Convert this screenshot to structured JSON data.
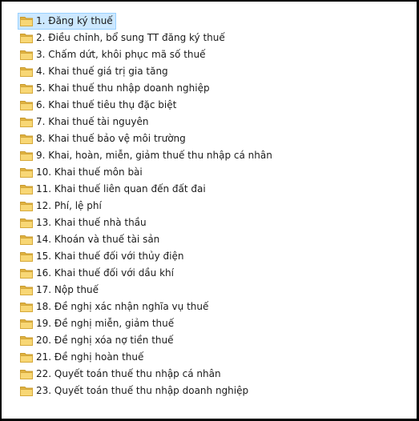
{
  "folders": {
    "selected_index": 0,
    "icon": "folder-icon",
    "colors": {
      "selection_fill": "#cce8ff",
      "selection_border": "#99d1ff",
      "folder_back": "#e0b240",
      "folder_front": "#f8d775"
    },
    "items": [
      {
        "label": "1. Đăng ký thuế"
      },
      {
        "label": "2. Điều chỉnh, bổ sung TT đăng ký thuế"
      },
      {
        "label": "3. Chấm dứt, khôi phục mã số thuế"
      },
      {
        "label": "4. Khai thuế giá trị gia tăng"
      },
      {
        "label": "5. Khai thuế thu nhập doanh nghiệp"
      },
      {
        "label": "6. Khai thuế tiêu thụ đặc biệt"
      },
      {
        "label": "7. Khai thuế tài nguyên"
      },
      {
        "label": "8. Khai thuế bảo vệ môi trường"
      },
      {
        "label": "9. Khai, hoàn, miễn, giảm thuế thu nhập cá nhân"
      },
      {
        "label": "10. Khai thuế môn bài"
      },
      {
        "label": "11. Khai thuế liên quan đến đất đai"
      },
      {
        "label": "12. Phí, lệ phí"
      },
      {
        "label": "13. Khai thuế nhà thầu"
      },
      {
        "label": "14. Khoán và thuế tài sản"
      },
      {
        "label": "15. Khai thuế đối với thủy điện"
      },
      {
        "label": "16. Khai thuế đối với dầu khí"
      },
      {
        "label": "17. Nộp thuế"
      },
      {
        "label": "18. Đề nghị xác nhận nghĩa vụ thuế"
      },
      {
        "label": "19. Đề nghị miễn, giảm thuế"
      },
      {
        "label": "20. Đề nghị xóa nợ tiền thuế"
      },
      {
        "label": "21. Đề nghị hoàn thuế"
      },
      {
        "label": "22. Quyết toán thuế thu nhập cá nhân"
      },
      {
        "label": "23. Quyết toán thuế thu nhập doanh nghiệp"
      }
    ]
  }
}
